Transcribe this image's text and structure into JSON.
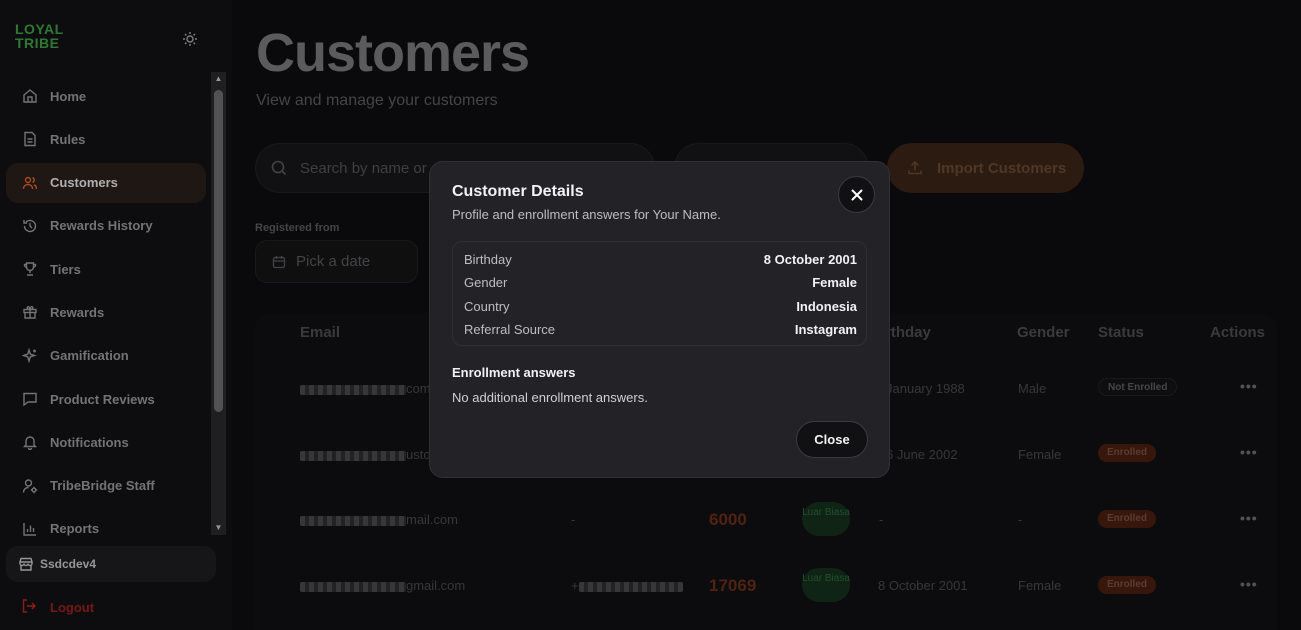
{
  "brand": {
    "line1": "LOYAL",
    "line2": "TRIBE"
  },
  "sidebar": {
    "items": [
      {
        "label": "Home",
        "icon": "home-icon"
      },
      {
        "label": "Rules",
        "icon": "document-icon"
      },
      {
        "label": "Customers",
        "icon": "users-icon",
        "active": true
      },
      {
        "label": "Rewards History",
        "icon": "history-icon"
      },
      {
        "label": "Tiers",
        "icon": "trophy-icon"
      },
      {
        "label": "Rewards",
        "icon": "gift-icon"
      },
      {
        "label": "Gamification",
        "icon": "sparkle-icon"
      },
      {
        "label": "Product Reviews",
        "icon": "message-icon"
      },
      {
        "label": "Notifications",
        "icon": "bell-icon"
      },
      {
        "label": "TribeBridge Staff",
        "icon": "staff-icon"
      },
      {
        "label": "Reports",
        "icon": "bar-chart-icon"
      }
    ],
    "store_name": "Ssdcdev4",
    "logout_label": "Logout"
  },
  "page": {
    "title": "Customers",
    "subtitle": "View and manage your customers",
    "search_placeholder": "Search by name or",
    "import_label": "Import Customers",
    "registered_from_label": "Registered from",
    "date_placeholder": "Pick a date"
  },
  "table": {
    "headers": {
      "email": "Email",
      "birthday": "rthday",
      "gender": "Gender",
      "status": "Status",
      "actions": "Actions"
    },
    "rows": [
      {
        "email_tail": "com",
        "phone": "",
        "points": "",
        "tier": "",
        "birthday": "January 1988",
        "gender": "Male",
        "status": "Not Enrolled",
        "status_kind": "not"
      },
      {
        "email_tail": "usto",
        "phone": "",
        "points": "",
        "tier": "",
        "birthday": "6 June 2002",
        "gender": "Female",
        "status": "Enrolled",
        "status_kind": "enrolled"
      },
      {
        "email_tail": "mail.com",
        "phone": "-",
        "points": "6000",
        "tier": "Luar Biasa",
        "birthday": "-",
        "gender": "-",
        "status": "Enrolled",
        "status_kind": "enrolled"
      },
      {
        "email_tail": "gmail.com",
        "phone": "+",
        "points": "17069",
        "tier": "Luar Biasa",
        "birthday": "8 October 2001",
        "gender": "Female",
        "status": "Enrolled",
        "status_kind": "enrolled"
      }
    ],
    "actions_glyph": "•••"
  },
  "modal": {
    "title": "Customer Details",
    "description": "Profile and enrollment answers for Your Name.",
    "details": [
      {
        "label": "Birthday",
        "value": "8 October 2001"
      },
      {
        "label": "Gender",
        "value": "Female"
      },
      {
        "label": "Country",
        "value": "Indonesia"
      },
      {
        "label": "Referral Source",
        "value": "Instagram"
      }
    ],
    "enrollment_heading": "Enrollment answers",
    "enrollment_text": "No additional enrollment answers.",
    "close_label": "Close"
  },
  "colors": {
    "accent": "#e0632b",
    "brand_green": "#3fa044",
    "logout_red": "#c0261f"
  }
}
